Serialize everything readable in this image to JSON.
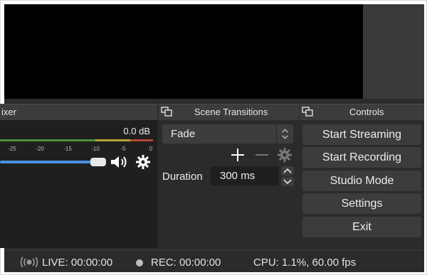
{
  "mixer": {
    "header_label": "ixer",
    "db_value": "0.0 dB",
    "ticks": [
      "-25",
      "-20",
      "-15",
      "-10",
      "-5",
      "0"
    ],
    "volume_level": 0.62
  },
  "transitions": {
    "header_label": "Scene Transitions",
    "selected": "Fade",
    "duration_label": "Duration",
    "duration_value": "300 ms",
    "tools": [
      "plus-icon",
      "minus-icon",
      "gear-icon"
    ]
  },
  "controls": {
    "header_label": "Controls",
    "buttons": [
      "Start Streaming",
      "Start Recording",
      "Studio Mode",
      "Settings",
      "Exit"
    ]
  },
  "status": {
    "live": "LIVE: 00:00:00",
    "rec": "REC: 00:00:00",
    "cpu": "CPU: 1.1%, 60.00 fps"
  },
  "colors": {
    "background": "#2b2b2b",
    "panel": "#3c3c3c",
    "accent": "#4a90e2"
  }
}
